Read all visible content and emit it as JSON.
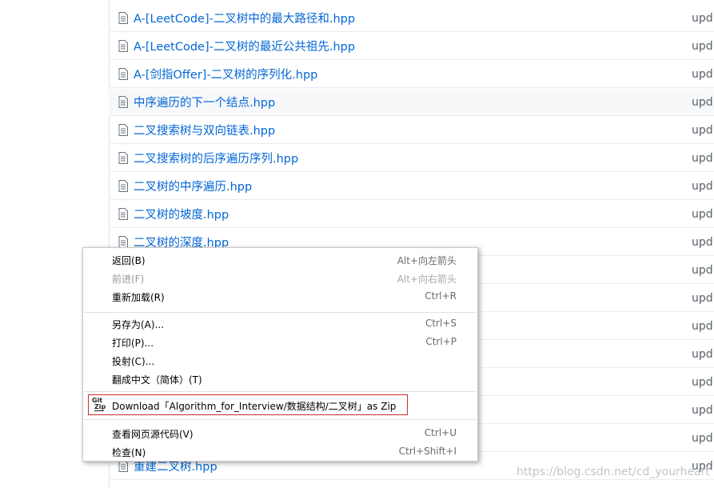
{
  "files": [
    {
      "name": "A-[LeetCode]-二叉树中的最大路径和.hpp",
      "commit": "upd"
    },
    {
      "name": "A-[LeetCode]-二叉树的最近公共祖先.hpp",
      "commit": "upd"
    },
    {
      "name": "A-[剑指Offer]-二叉树的序列化.hpp",
      "commit": "upd"
    },
    {
      "name": "中序遍历的下一个结点.hpp",
      "commit": "upd"
    },
    {
      "name": "二叉搜索树与双向链表.hpp",
      "commit": "upd"
    },
    {
      "name": "二叉搜索树的后序遍历序列.hpp",
      "commit": "upd"
    },
    {
      "name": "二叉树的中序遍历.hpp",
      "commit": "upd"
    },
    {
      "name": "二叉树的坡度.hpp",
      "commit": "upd"
    },
    {
      "name": "二叉树的深度.hpp",
      "commit": "upd"
    },
    {
      "name": "",
      "commit": "upd"
    },
    {
      "name": "",
      "commit": "upd"
    },
    {
      "name": "",
      "commit": "upd"
    },
    {
      "name": "",
      "commit": "upd"
    },
    {
      "name": "",
      "commit": "upd"
    },
    {
      "name": "",
      "commit": "upd"
    },
    {
      "name": "",
      "commit": "upd"
    },
    {
      "name": "重建二叉树.hpp",
      "commit": "upd"
    }
  ],
  "context_menu": {
    "back": {
      "label": "返回(B)",
      "shortcut": "Alt+向左箭头"
    },
    "forward": {
      "label": "前进(F)",
      "shortcut": "Alt+向右箭头"
    },
    "reload": {
      "label": "重新加载(R)",
      "shortcut": "Ctrl+R"
    },
    "save_as": {
      "label": "另存为(A)...",
      "shortcut": "Ctrl+S"
    },
    "print": {
      "label": "打印(P)...",
      "shortcut": "Ctrl+P"
    },
    "cast": {
      "label": "投射(C)..."
    },
    "translate": {
      "label": "翻成中文（简体）(T)"
    },
    "gitzip": {
      "icon_top": "Git",
      "icon_bottom": "Zip",
      "label": "Download「Algorithm_for_Interview/数据结构/二叉树」as Zip"
    },
    "view_source": {
      "label": "查看网页源代码(V)",
      "shortcut": "Ctrl+U"
    },
    "inspect": {
      "label": "检查(N)",
      "shortcut": "Ctrl+Shift+I"
    }
  },
  "watermark": "https://blog.csdn.net/cd_yourheart",
  "colors": {
    "link": "#0366d6",
    "row_border": "#eaecef",
    "highlight_box": "#c62f2f"
  }
}
